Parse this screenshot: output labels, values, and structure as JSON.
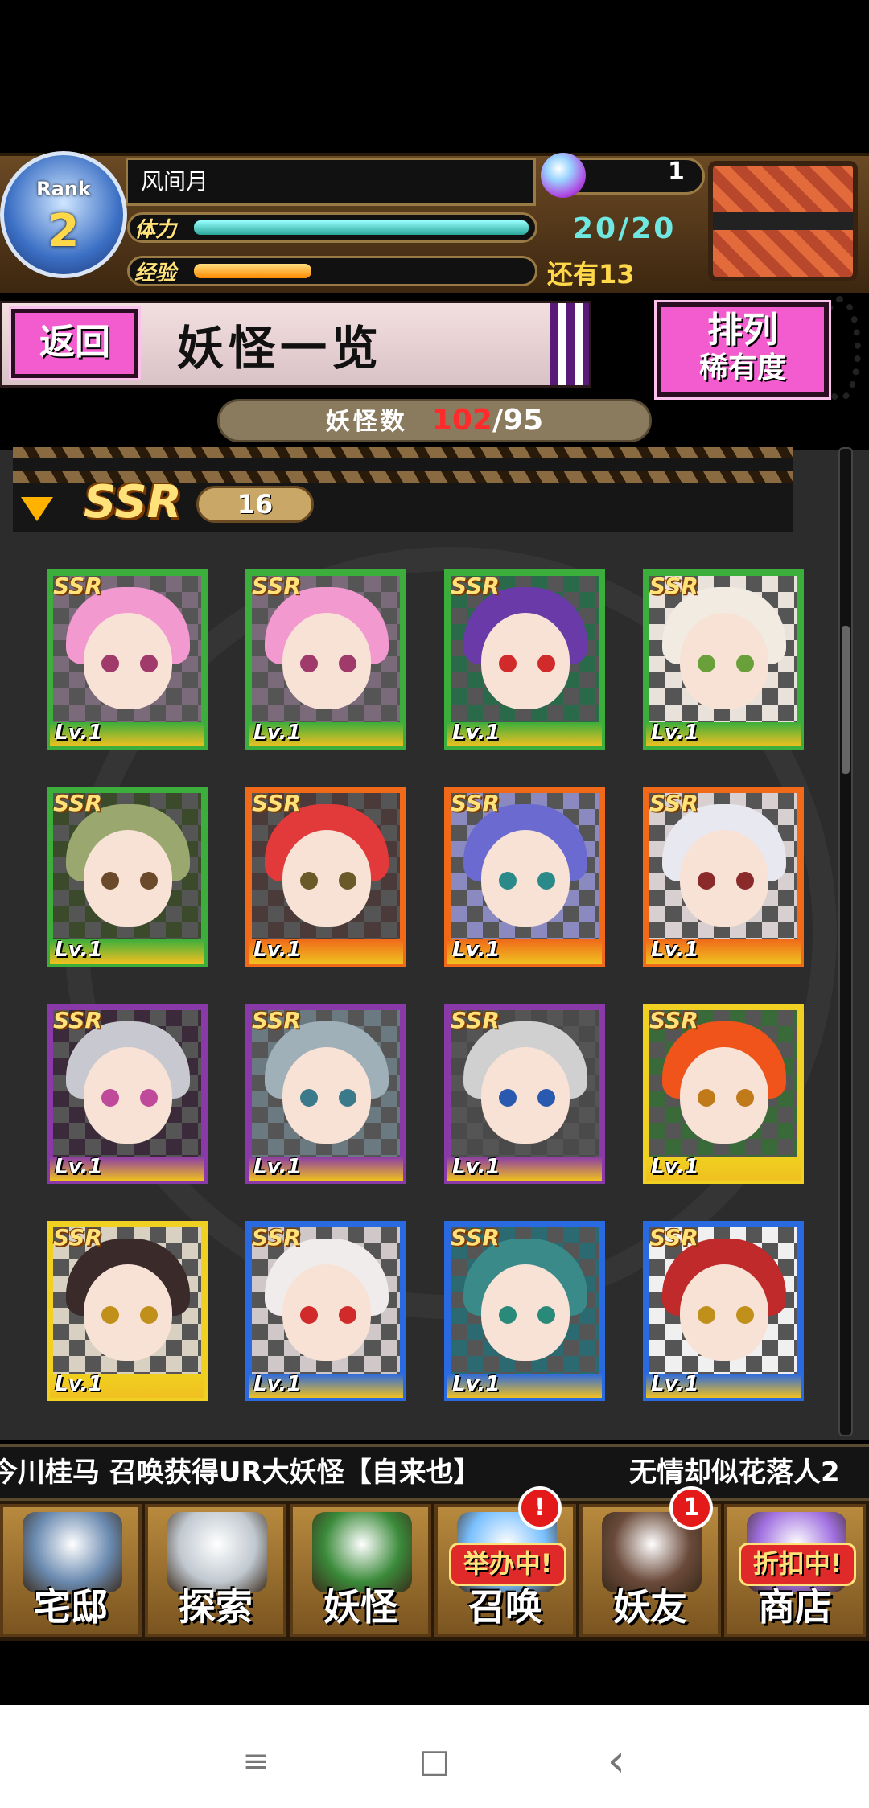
{
  "player": {
    "rank_label": "Rank",
    "rank_value": "2",
    "name": "风间月",
    "stamina_label": "体力",
    "stamina_value": "20/20",
    "stamina_fraction": 1.0,
    "exp_label": "经验",
    "exp_remaining": "还有13",
    "exp_fraction": 0.35,
    "currency_value": "1"
  },
  "page": {
    "back_label": "返回",
    "title": "妖怪一览",
    "sort_line1": "排列",
    "sort_line2": "稀有度",
    "count_label": "妖怪数",
    "count_current": "102",
    "count_sep": "/",
    "count_max": "95"
  },
  "group": {
    "rarity": "SSR",
    "count": "16"
  },
  "cards": [
    {
      "rarity": "SSR",
      "level": "Lv.1",
      "frame": "#3cae3c",
      "hair": "#f29ad0",
      "eye": "#a03a6a",
      "bg": "#7a6a7a"
    },
    {
      "rarity": "SSR",
      "level": "Lv.1",
      "frame": "#3cae3c",
      "hair": "#f29ad0",
      "eye": "#a03a6a",
      "bg": "#7a6a7a"
    },
    {
      "rarity": "SSR",
      "level": "Lv.1",
      "frame": "#3cae3c",
      "hair": "#6a3aa8",
      "eye": "#d02a2a",
      "bg": "#2a6a4a"
    },
    {
      "rarity": "SSR",
      "level": "Lv.1",
      "frame": "#3cae3c",
      "hair": "#f1ebe2",
      "eye": "#6aa03a",
      "bg": "#e8e2da"
    },
    {
      "rarity": "SSR",
      "level": "Lv.1",
      "frame": "#3cae3c",
      "hair": "#9aa870",
      "eye": "#6a4a2a",
      "bg": "#3a4a2a"
    },
    {
      "rarity": "SSR",
      "level": "Lv.1",
      "frame": "#f06a1a",
      "hair": "#e23a3a",
      "eye": "#6a5a2a",
      "bg": "#4a3a3a"
    },
    {
      "rarity": "SSR",
      "level": "Lv.1",
      "frame": "#f06a1a",
      "hair": "#6a6ad0",
      "eye": "#2a8a8a",
      "bg": "#8a8ac0"
    },
    {
      "rarity": "SSR",
      "level": "Lv.1",
      "frame": "#f06a1a",
      "hair": "#e8e8f0",
      "eye": "#8a2a2a",
      "bg": "#d8d0d0"
    },
    {
      "rarity": "SSR",
      "level": "Lv.1",
      "frame": "#8a3aa8",
      "hair": "#c8c8d0",
      "eye": "#c04a9a",
      "bg": "#3a2a3a"
    },
    {
      "rarity": "SSR",
      "level": "Lv.1",
      "frame": "#8a3aa8",
      "hair": "#a0b0b8",
      "eye": "#3a7a8a",
      "bg": "#6a7a80"
    },
    {
      "rarity": "SSR",
      "level": "Lv.1",
      "frame": "#8a3aa8",
      "hair": "#d0d0d0",
      "eye": "#2a5ab0",
      "bg": "#4a4a4a"
    },
    {
      "rarity": "SSR",
      "level": "Lv.1",
      "frame": "#f0d020",
      "hair": "#f0541a",
      "eye": "#c07a1a",
      "bg": "#3a6a3a"
    },
    {
      "rarity": "SSR",
      "level": "Lv.1",
      "frame": "#f0d020",
      "hair": "#3a2a2a",
      "eye": "#c0901a",
      "bg": "#d8d0c0"
    },
    {
      "rarity": "SSR",
      "level": "Lv.1",
      "frame": "#2a6ae0",
      "hair": "#f0ecec",
      "eye": "#d02a2a",
      "bg": "#d0c8c8"
    },
    {
      "rarity": "SSR",
      "level": "Lv.1",
      "frame": "#2a6ae0",
      "hair": "#3a8a8a",
      "eye": "#2a8a7a",
      "bg": "#2a6a70"
    },
    {
      "rarity": "SSR",
      "level": "Lv.1",
      "frame": "#2a6ae0",
      "hair": "#c02a2a",
      "eye": "#c0901a",
      "bg": "#f0f0f0"
    }
  ],
  "ticker": {
    "text1": "今川桂马 召唤获得UR大妖怪【自来也】",
    "text2": "无情却似花落人2"
  },
  "nav": [
    {
      "label": "宅邸",
      "promo": "",
      "badge": "",
      "color": "#6a8ab0"
    },
    {
      "label": "探索",
      "promo": "",
      "badge": "",
      "color": "#c0c8d0"
    },
    {
      "label": "妖怪",
      "promo": "",
      "badge": "",
      "color": "#3a8a3a"
    },
    {
      "label": "召唤",
      "promo": "举办中!",
      "badge": "!",
      "color": "#7ac0ff"
    },
    {
      "label": "妖友",
      "promo": "",
      "badge": "1",
      "color": "#6a4a3a"
    },
    {
      "label": "商店",
      "promo": "折扣中!",
      "badge": "",
      "color": "#a070e0"
    }
  ],
  "android_nav": {
    "menu": "≡",
    "home": "□",
    "back": "‹"
  },
  "colors": {
    "pink_button": "#f25ccf",
    "count_red": "#ff2a2a",
    "stamina": "#4ad0c0",
    "exp": "#ffa020"
  }
}
